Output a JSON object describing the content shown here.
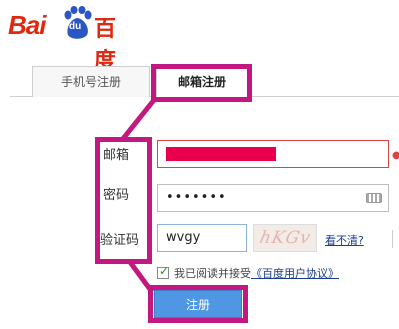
{
  "logo": {
    "latin": "Bai",
    "du": "du",
    "chinese": "百度"
  },
  "tabs": [
    {
      "label": "手机号注册"
    },
    {
      "label": "邮箱注册"
    }
  ],
  "form": {
    "email_label": "邮箱",
    "password_label": "密码",
    "code_label": "验证码",
    "password_value": "•••••••",
    "code_value": "wvgy",
    "captcha_text": "hKGv",
    "refresh_link": "看不清?"
  },
  "agreement": {
    "prefix": "我已阅读并接受",
    "link": "《百度用户协议》"
  },
  "submit_label": "注册",
  "colors": {
    "brand_red": "#de2910",
    "highlight": "#c2187f",
    "button_blue": "#4f96e3"
  }
}
